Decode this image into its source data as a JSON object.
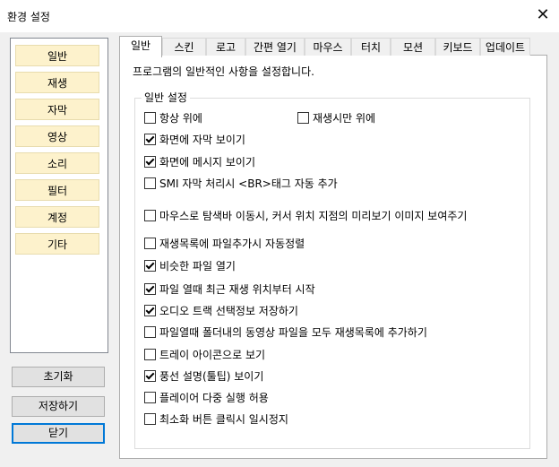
{
  "window": {
    "title": "환경 설정"
  },
  "nav": [
    {
      "label": "일반",
      "selected": true
    },
    {
      "label": "재생",
      "selected": false
    },
    {
      "label": "자막",
      "selected": false
    },
    {
      "label": "영상",
      "selected": false
    },
    {
      "label": "소리",
      "selected": false
    },
    {
      "label": "필터",
      "selected": false
    },
    {
      "label": "계정",
      "selected": false
    },
    {
      "label": "기타",
      "selected": false
    }
  ],
  "actions": {
    "reset": "초기화",
    "save": "저장하기",
    "close": "닫기"
  },
  "tabs": [
    {
      "label": "일반",
      "active": true
    },
    {
      "label": "스킨",
      "active": false
    },
    {
      "label": "로고",
      "active": false
    },
    {
      "label": "간편 열기",
      "active": false
    },
    {
      "label": "마우스",
      "active": false
    },
    {
      "label": "터치",
      "active": false
    },
    {
      "label": "모션",
      "active": false
    },
    {
      "label": "키보드",
      "active": false
    },
    {
      "label": "업데이트",
      "active": false
    }
  ],
  "panel": {
    "description": "프로그램의 일반적인 사항을 설정합니다.",
    "group_title": "일반 설정",
    "options": [
      {
        "label": "항상 위에",
        "checked": false
      },
      {
        "label": "재생시만 위에",
        "checked": false
      },
      {
        "label": "화면에 자막 보이기",
        "checked": true
      },
      {
        "label": "화면에 메시지 보이기",
        "checked": true
      },
      {
        "label": "SMI 자막 처리시 <BR>태그 자동 추가",
        "checked": false
      },
      {
        "label": "마우스로 탐색바 이동시, 커서 위치 지점의 미리보기 이미지 보여주기",
        "checked": false
      },
      {
        "label": "재생목록에 파일추가시 자동정렬",
        "checked": false
      },
      {
        "label": "비슷한 파일 열기",
        "checked": true
      },
      {
        "label": "파일 열때 최근 재생 위치부터 시작",
        "checked": true
      },
      {
        "label": "오디오 트랙 선택정보 저장하기",
        "checked": true
      },
      {
        "label": "파일열때 폴더내의 동영상 파일을 모두 재생목록에 추가하기",
        "checked": false
      },
      {
        "label": "트레이 아이콘으로 보기",
        "checked": false
      },
      {
        "label": "풍선 설명(툴팁) 보이기",
        "checked": true
      },
      {
        "label": "플레이어 다중 실행 허용",
        "checked": false
      },
      {
        "label": "최소화 버튼 클릭시 일시정지",
        "checked": false
      }
    ]
  }
}
